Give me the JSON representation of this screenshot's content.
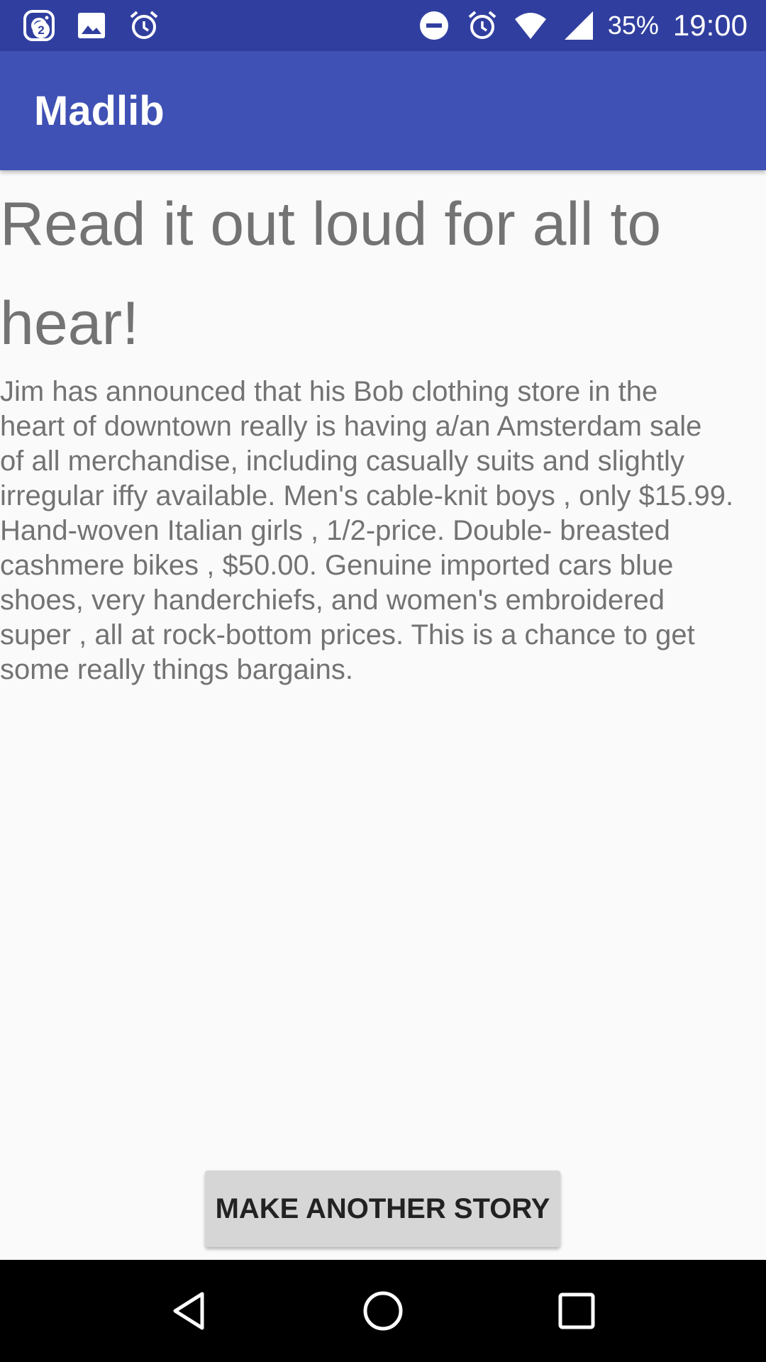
{
  "status_bar": {
    "notification_count": "2",
    "battery": "35%",
    "time": "19:00",
    "icons": {
      "left": [
        "instagram-icon",
        "image-icon",
        "alarm-icon"
      ],
      "right": [
        "do-not-disturb-icon",
        "alarm-icon",
        "wifi-icon",
        "signal-icon"
      ]
    }
  },
  "app_bar": {
    "title": "Madlib"
  },
  "main": {
    "heading": "Read it out loud for all to\nhear!",
    "story": " Jim has announced that his Bob clothing store in the\nheart of downtown really is having a/an Amsterdam sale\nof all merchandise, including casually suits and slightly\nirregular iffy available. Men's cable-knit boys , only $15.99.\nHand-woven Italian girls , 1/2-price. Double- breasted\ncashmere bikes , $50.00. Genuine imported cars blue\nshoes, very handerchiefs, and women's embroidered\nsuper , all at rock-bottom prices. This is a chance to get\nsome really things bargains.",
    "button_label": "MAKE ANOTHER STORY"
  },
  "nav_bar": {
    "icons": [
      "back-icon",
      "home-icon",
      "recents-icon"
    ]
  },
  "colors": {
    "status_bar": "#303f9f",
    "app_bar": "#3f51b5",
    "background": "#fafafa",
    "text": "#737373",
    "button": "#d6d6d6"
  }
}
